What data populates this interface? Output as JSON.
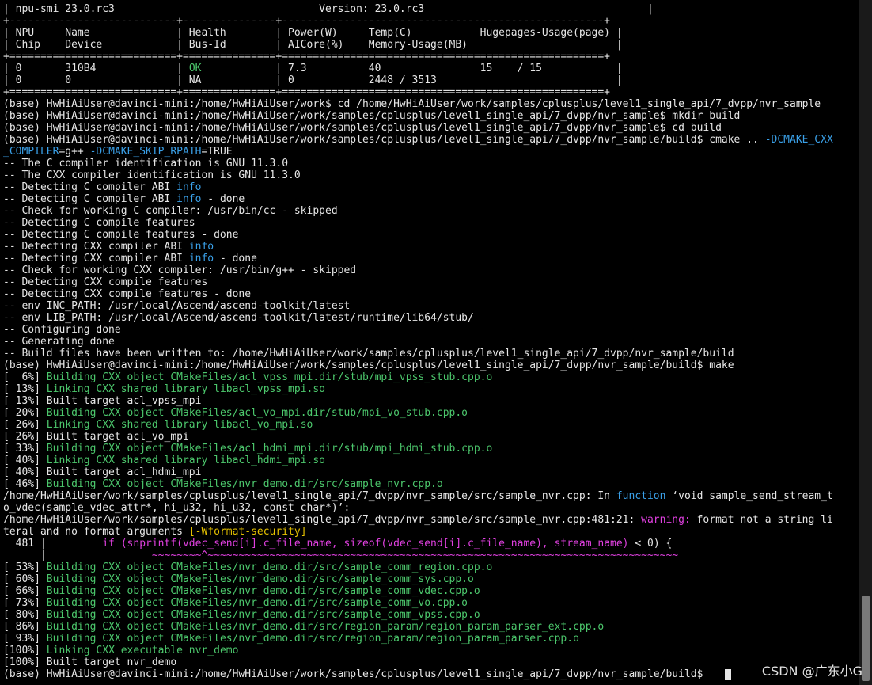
{
  "colors": {
    "background": "#000000",
    "text": "#e6e6e6",
    "green": "#4cc76c",
    "cyan": "#3aa0e8",
    "magenta": "#e040e0",
    "yellow": "#e5c100",
    "blue": "#4d8ef0"
  },
  "terminal": {
    "lines": [
      [
        {
          "t": "| npu-smi 23.0.rc3                                 Version: 23.0.rc3                                    |",
          "c": "white"
        }
      ],
      [
        {
          "t": "+---------------------------+---------------+----------------------------------------------------+",
          "c": "white"
        }
      ],
      [
        {
          "t": "| NPU     Name              | Health        | Power(W)     Temp(C)           Hugepages-Usage(page) |",
          "c": "white"
        }
      ],
      [
        {
          "t": "| Chip    Device            | Bus-Id        | AICore(%)    Memory-Usage(MB)                        |",
          "c": "white"
        }
      ],
      [
        {
          "t": "+===========================+===============+====================================================+",
          "c": "white"
        }
      ],
      [
        {
          "t": "| 0       310B4             | ",
          "c": "white"
        },
        {
          "t": "OK",
          "c": "green"
        },
        {
          "t": "            | 7.3          40                15    / 15            |",
          "c": "white"
        }
      ],
      [
        {
          "t": "| 0       0                 | NA            | 0            2448 / 3513                             |",
          "c": "white"
        }
      ],
      [
        {
          "t": "+===========================+===============+====================================================+",
          "c": "white"
        }
      ],
      [
        {
          "t": "(base) HwHiAiUser@davinci-mini:/home/HwHiAiUser/work$ cd /home/HwHiAiUser/work/samples/cplusplus/level1_single_api/7_dvpp/nvr_sample",
          "c": "white"
        }
      ],
      [
        {
          "t": "(base) HwHiAiUser@davinci-mini:/home/HwHiAiUser/work/samples/cplusplus/level1_single_api/7_dvpp/nvr_sample$ mkdir build",
          "c": "white"
        }
      ],
      [
        {
          "t": "(base) HwHiAiUser@davinci-mini:/home/HwHiAiUser/work/samples/cplusplus/level1_single_api/7_dvpp/nvr_sample$ cd build",
          "c": "white"
        }
      ],
      [
        {
          "t": "(base) HwHiAiUser@davinci-mini:/home/HwHiAiUser/work/samples/cplusplus/level1_single_api/7_dvpp/nvr_sample/build$ cmake .. ",
          "c": "white"
        },
        {
          "t": "-DCMAKE_CXX",
          "c": "cyan"
        }
      ],
      [
        {
          "t": "_COMPILER",
          "c": "cyan"
        },
        {
          "t": "=g++ ",
          "c": "white"
        },
        {
          "t": "-DCMAKE_SKIP_RPATH",
          "c": "cyan"
        },
        {
          "t": "=TRUE",
          "c": "white"
        }
      ],
      [
        {
          "t": "-- The C compiler identification is GNU 11.3.0",
          "c": "white"
        }
      ],
      [
        {
          "t": "-- The CXX compiler identification is GNU 11.3.0",
          "c": "white"
        }
      ],
      [
        {
          "t": "-- Detecting C compiler ABI ",
          "c": "white"
        },
        {
          "t": "info",
          "c": "cyan"
        }
      ],
      [
        {
          "t": "-- Detecting C compiler ABI ",
          "c": "white"
        },
        {
          "t": "info",
          "c": "cyan"
        },
        {
          "t": " - done",
          "c": "white"
        }
      ],
      [
        {
          "t": "-- Check for working C compiler: /usr/bin/cc - skipped",
          "c": "white"
        }
      ],
      [
        {
          "t": "-- Detecting C compile features",
          "c": "white"
        }
      ],
      [
        {
          "t": "-- Detecting C compile features - done",
          "c": "white"
        }
      ],
      [
        {
          "t": "-- Detecting CXX compiler ABI ",
          "c": "white"
        },
        {
          "t": "info",
          "c": "cyan"
        }
      ],
      [
        {
          "t": "-- Detecting CXX compiler ABI ",
          "c": "white"
        },
        {
          "t": "info",
          "c": "cyan"
        },
        {
          "t": " - done",
          "c": "white"
        }
      ],
      [
        {
          "t": "-- Check for working CXX compiler: /usr/bin/g++ - skipped",
          "c": "white"
        }
      ],
      [
        {
          "t": "-- Detecting CXX compile features",
          "c": "white"
        }
      ],
      [
        {
          "t": "-- Detecting CXX compile features - done",
          "c": "white"
        }
      ],
      [
        {
          "t": "-- env INC_PATH: /usr/local/Ascend/ascend-toolkit/latest",
          "c": "white"
        }
      ],
      [
        {
          "t": "-- env LIB_PATH: /usr/local/Ascend/ascend-toolkit/latest/runtime/lib64/stub/",
          "c": "white"
        }
      ],
      [
        {
          "t": "-- Configuring done",
          "c": "white"
        }
      ],
      [
        {
          "t": "-- Generating done",
          "c": "white"
        }
      ],
      [
        {
          "t": "-- Build files have been written to: /home/HwHiAiUser/work/samples/cplusplus/level1_single_api/7_dvpp/nvr_sample/build",
          "c": "white"
        }
      ],
      [
        {
          "t": "(base) HwHiAiUser@davinci-mini:/home/HwHiAiUser/work/samples/cplusplus/level1_single_api/7_dvpp/nvr_sample/build$ make",
          "c": "white"
        }
      ],
      [
        {
          "t": "[  6%] ",
          "c": "white"
        },
        {
          "t": "Building CXX object CMakeFiles/acl_vpss_mpi.dir/stub/mpi_vpss_stub.cpp.o",
          "c": "green"
        }
      ],
      [
        {
          "t": "[ 13%] ",
          "c": "white"
        },
        {
          "t": "Linking CXX shared library libacl_vpss_mpi.so",
          "c": "green"
        }
      ],
      [
        {
          "t": "[ 13%] Built target acl_vpss_mpi",
          "c": "white"
        }
      ],
      [
        {
          "t": "[ 20%] ",
          "c": "white"
        },
        {
          "t": "Building CXX object CMakeFiles/acl_vo_mpi.dir/stub/mpi_vo_stub.cpp.o",
          "c": "green"
        }
      ],
      [
        {
          "t": "[ 26%] ",
          "c": "white"
        },
        {
          "t": "Linking CXX shared library libacl_vo_mpi.so",
          "c": "green"
        }
      ],
      [
        {
          "t": "[ 26%] Built target acl_vo_mpi",
          "c": "white"
        }
      ],
      [
        {
          "t": "[ 33%] ",
          "c": "white"
        },
        {
          "t": "Building CXX object CMakeFiles/acl_hdmi_mpi.dir/stub/mpi_hdmi_stub.cpp.o",
          "c": "green"
        }
      ],
      [
        {
          "t": "[ 40%] ",
          "c": "white"
        },
        {
          "t": "Linking CXX shared library libacl_hdmi_mpi.so",
          "c": "green"
        }
      ],
      [
        {
          "t": "[ 40%] Built target acl_hdmi_mpi",
          "c": "white"
        }
      ],
      [
        {
          "t": "[ 46%] ",
          "c": "white"
        },
        {
          "t": "Building CXX object CMakeFiles/nvr_demo.dir/src/sample_nvr.cpp.o",
          "c": "green"
        }
      ],
      [
        {
          "t": "/home/HwHiAiUser/work/samples/cplusplus/level1_single_api/7_dvpp/nvr_sample/src/sample_nvr.cpp: In ",
          "c": "white"
        },
        {
          "t": "function",
          "c": "cyan"
        },
        {
          "t": " ‘void sample_send_stream_t",
          "c": "white"
        }
      ],
      [
        {
          "t": "o_vdec(sample_vdec_attr*, hi_u32, hi_u32, const char*)’:",
          "c": "white"
        }
      ],
      [
        {
          "t": "/home/HwHiAiUser/work/samples/cplusplus/level1_single_api/7_dvpp/nvr_sample/src/sample_nvr.cpp:481:21: ",
          "c": "white"
        },
        {
          "t": "warning:",
          "c": "magenta"
        },
        {
          "t": " format not a string li",
          "c": "white"
        }
      ],
      [
        {
          "t": "teral and no format arguments ",
          "c": "white"
        },
        {
          "t": "[-Wformat-security]",
          "c": "yellow"
        }
      ],
      [
        {
          "t": "  481 |         ",
          "c": "white"
        },
        {
          "t": "if (snprintf(vdec_send[i].c_file_name, sizeof(vdec_send[i].c_file_name), stream_name)",
          "c": "magenta"
        },
        {
          "t": " < 0) {",
          "c": "white"
        }
      ],
      [
        {
          "t": "      |         ",
          "c": "white"
        },
        {
          "t": "        ~~~~~~~~^~~~~~~~~~~~~~~~~~~~~~~~~~~~~~~~~~~~~~~~~~~~~~~~~~~~~~~~~~~~~~~~~~~~~~~~~~~~~",
          "c": "magenta"
        }
      ],
      [
        {
          "t": "[ 53%] ",
          "c": "white"
        },
        {
          "t": "Building CXX object CMakeFiles/nvr_demo.dir/src/sample_comm_region.cpp.o",
          "c": "green"
        }
      ],
      [
        {
          "t": "[ 60%] ",
          "c": "white"
        },
        {
          "t": "Building CXX object CMakeFiles/nvr_demo.dir/src/sample_comm_sys.cpp.o",
          "c": "green"
        }
      ],
      [
        {
          "t": "[ 66%] ",
          "c": "white"
        },
        {
          "t": "Building CXX object CMakeFiles/nvr_demo.dir/src/sample_comm_vdec.cpp.o",
          "c": "green"
        }
      ],
      [
        {
          "t": "[ 73%] ",
          "c": "white"
        },
        {
          "t": "Building CXX object CMakeFiles/nvr_demo.dir/src/sample_comm_vo.cpp.o",
          "c": "green"
        }
      ],
      [
        {
          "t": "[ 80%] ",
          "c": "white"
        },
        {
          "t": "Building CXX object CMakeFiles/nvr_demo.dir/src/sample_comm_vpss.cpp.o",
          "c": "green"
        }
      ],
      [
        {
          "t": "[ 86%] ",
          "c": "white"
        },
        {
          "t": "Building CXX object CMakeFiles/nvr_demo.dir/src/region_param/region_param_parser_ext.cpp.o",
          "c": "green"
        }
      ],
      [
        {
          "t": "[ 93%] ",
          "c": "white"
        },
        {
          "t": "Building CXX object CMakeFiles/nvr_demo.dir/src/region_param/region_param_parser.cpp.o",
          "c": "green"
        }
      ],
      [
        {
          "t": "[100%] ",
          "c": "white"
        },
        {
          "t": "Linking CXX executable nvr_demo",
          "c": "green"
        }
      ],
      [
        {
          "t": "[100%] Built target nvr_demo",
          "c": "white"
        }
      ],
      [
        {
          "t": "(base) HwHiAiUser@davinci-mini:/home/HwHiAiUser/work/samples/cplusplus/level1_single_api/7_dvpp/nvr_sample/build$ ",
          "c": "white"
        }
      ]
    ]
  },
  "watermark": {
    "text": "CSDN @广东小G"
  }
}
